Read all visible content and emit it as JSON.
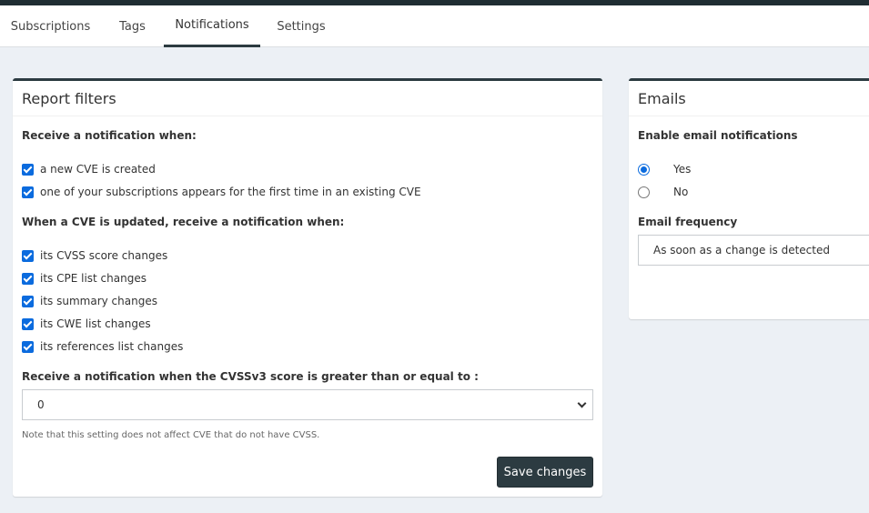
{
  "tabs": [
    {
      "label": "Subscriptions"
    },
    {
      "label": "Tags"
    },
    {
      "label": "Notifications"
    },
    {
      "label": "Settings"
    }
  ],
  "report_filters": {
    "title": "Report filters",
    "receive_when_label": "Receive a notification when:",
    "new_cve": {
      "label": "a new CVE is created",
      "checked": true
    },
    "first_time": {
      "label": "one of your subscriptions appears for the first time in an existing CVE",
      "checked": true
    },
    "updated_label": "When a CVE is updated, receive a notification when:",
    "updates": [
      {
        "label": "its CVSS score changes",
        "checked": true
      },
      {
        "label": "its CPE list changes",
        "checked": true
      },
      {
        "label": "its summary changes",
        "checked": true
      },
      {
        "label": "its CWE list changes",
        "checked": true
      },
      {
        "label": "its references list changes",
        "checked": true
      }
    ],
    "cvss_label": "Receive a notification when the CVSSv3 score is greater than or equal to :",
    "cvss_value": "0",
    "note": "Note that this setting does not affect CVE that do not have CVSS.",
    "save_label": "Save changes"
  },
  "emails": {
    "title": "Emails",
    "enable_label": "Enable email notifications",
    "yes_label": "Yes",
    "no_label": "No",
    "selected": "Yes",
    "frequency_label": "Email frequency",
    "frequency_value": "As soon as a change is detected"
  },
  "colors": {
    "accent": "#0b6bde",
    "dark": "#2c3b41",
    "background": "#ecf0f5"
  }
}
